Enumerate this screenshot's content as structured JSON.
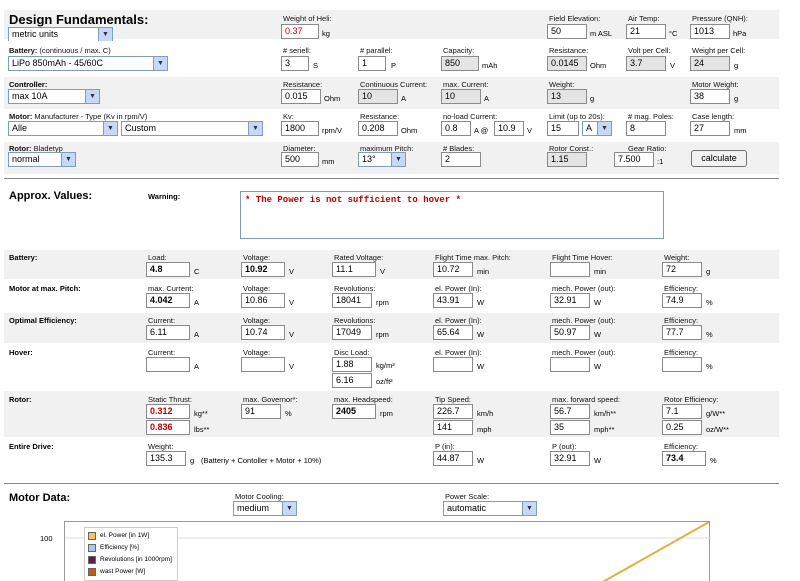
{
  "design": {
    "title": "Design Fundamentals:",
    "units": "metric units"
  },
  "heli_weight": {
    "label": "Weight of Heli:",
    "value": "0.37",
    "unit": "kg"
  },
  "field": {
    "label": "Field Elevation:",
    "value": "50",
    "unit": "m ASL"
  },
  "air": {
    "label": "Air Temp:",
    "value": "21",
    "unit": "°C"
  },
  "pressure": {
    "label": "Pressure (QNH):",
    "value": "1013",
    "unit": "hPa"
  },
  "battery": {
    "label_bold": "Battery:",
    "label_rest": " (continuous / max. C)",
    "type": "LiPo 850mAh - 45/60C",
    "seriell_label": "# seriell:",
    "seriell": "3",
    "seriell_unit": "S",
    "parallel_label": "# parallel:",
    "parallel": "1",
    "parallel_unit": "P",
    "capacity_label": "Capacity:",
    "capacity": "850",
    "capacity_unit": "mAh",
    "resistance_label": "Resistance:",
    "resistance": "0.0145",
    "resistance_unit": "Ohm",
    "volt_label": "Volt per Cell:",
    "volt": "3.7",
    "volt_unit": "V",
    "weight_label": "Weight per Cell:",
    "weight": "24",
    "weight_unit": "g"
  },
  "controller": {
    "label": "Controller:",
    "type": "max 10A",
    "resistance_label": "Resistance:",
    "resistance": "0.015",
    "resistance_unit": "Ohm",
    "cont_label": "Continuous Current:",
    "cont": "10",
    "cont_unit": "A",
    "max_label": "max. Current:",
    "max": "10",
    "max_unit": "A",
    "weight_label": "Weight:",
    "weight": "13",
    "weight_unit": "g",
    "motor_weight_label": "Motor Weight:",
    "motor_weight": "38",
    "motor_weight_unit": "g"
  },
  "motor": {
    "label_bold": "Motor:",
    "label_rest": " Manufacturer - Type (Kv in rpm/V)",
    "manufacturer": "Alle",
    "type": "Custom",
    "kv_label": "Kv:",
    "kv": "1800",
    "kv_unit": "rpm/V",
    "resistance_label": "Resistance:",
    "resistance": "0.208",
    "resistance_unit": "Ohm",
    "noload_label": "no-load Current:",
    "noload": "0.8",
    "noload_mid": "A @",
    "noload_v": "10.9",
    "noload_unit": "V",
    "limit_label": "Limit (up to 20s):",
    "limit": "15",
    "limit_unit": "A",
    "poles_label": "# mag. Poles:",
    "poles": "8",
    "case_label": "Case length:",
    "case": "27",
    "case_unit": "mm"
  },
  "rotor": {
    "label_bold": "Rotor:",
    "label_rest": " Bladetyp",
    "type": "normal",
    "diameter_label": "Diameter:",
    "diameter": "500",
    "diameter_unit": "mm",
    "pitch_label": "maximum Pitch:",
    "pitch": "13°",
    "blades_label": "# Blades:",
    "blades": "2",
    "const_label": "Rotor Const.:",
    "const": "1.15",
    "gear_label": "Gear Ratio:",
    "gear": "7.500",
    "gear_unit": ":1",
    "calculate": "calculate"
  },
  "approx": {
    "title": "Approx. Values:",
    "warning_label": "Warning:",
    "warning_text": "* The Power is not sufficient to hover *"
  },
  "bat_row": {
    "label": "Battery:",
    "load_label": "Load:",
    "load": "4.8",
    "load_unit": "C",
    "voltage_label": "Voltage:",
    "voltage": "10.92",
    "voltage_unit": "V",
    "rated_label": "Rated Voltage:",
    "rated": "11.1",
    "rated_unit": "V",
    "ftmax_label": "Flight Time max. Pitch:",
    "ftmax": "10.72",
    "ftmax_unit": "min",
    "fthover_label": "Flight Time Hover:",
    "fthover": "",
    "fthover_unit": "min",
    "weight_label": "Weight:",
    "weight": "72",
    "weight_unit": "g"
  },
  "motor_row": {
    "label": "Motor at max. Pitch:",
    "current_label": "max. Current:",
    "current": "4.042",
    "current_unit": "A",
    "voltage_label": "Voltage:",
    "voltage": "10.86",
    "voltage_unit": "V",
    "rev_label": "Revolutions:",
    "rev": "18041",
    "rev_unit": "rpm",
    "pin_label": "el. Power (In):",
    "pin": "43.91",
    "pin_unit": "W",
    "pout_label": "mech. Power (out):",
    "pout": "32.91",
    "pout_unit": "W",
    "eff_label": "Efficiency:",
    "eff": "74.9",
    "eff_unit": "%"
  },
  "opt_row": {
    "label": "Optimal Efficiency:",
    "current_label": "Current:",
    "current": "6.11",
    "current_unit": "A",
    "voltage_label": "Voltage:",
    "voltage": "10.74",
    "voltage_unit": "V",
    "rev_label": "Revolutions:",
    "rev": "17049",
    "rev_unit": "rpm",
    "pin_label": "el. Power (In):",
    "pin": "65.64",
    "pin_unit": "W",
    "pout_label": "mech. Power (out):",
    "pout": "50.97",
    "pout_unit": "W",
    "eff_label": "Efficiency:",
    "eff": "77.7",
    "eff_unit": "%"
  },
  "hover_row": {
    "label": "Hover:",
    "current_label": "Current:",
    "current": "",
    "current_unit": "A",
    "voltage_label": "Voltage:",
    "voltage": "",
    "voltage_unit": "V",
    "disc_label": "Disc Load:",
    "disc1": "1.88",
    "disc1_unit": "kg/m²",
    "disc2": "6.16",
    "disc2_unit": "oz/ft²",
    "pin_label": "el. Power (In):",
    "pin": "",
    "pin_unit": "W",
    "pout_label": "mech. Power (out):",
    "pout": "",
    "pout_unit": "W",
    "eff_label": "Efficiency:",
    "eff": "",
    "eff_unit": "%"
  },
  "rotor_row": {
    "label": "Rotor:",
    "thrust_label": "Static Thrust:",
    "thrust1": "0.312",
    "thrust1_unit": "kg**",
    "thrust2": "0.836",
    "thrust2_unit": "lbs**",
    "gov_label": "max. Governor*:",
    "gov": "91",
    "gov_unit": "%",
    "head_label": "max. Headspeed:",
    "head": "2405",
    "head_unit": "rpm",
    "tip_label": "Tip Speed:",
    "tip1": "226.7",
    "tip1_unit": "km/h",
    "tip2": "141",
    "tip2_unit": "mph",
    "fwd_label": "max. forward speed:",
    "fwd1": "56.7",
    "fwd1_unit": "km/h**",
    "fwd2": "35",
    "fwd2_unit": "mph**",
    "reff_label": "Rotor Efficiency:",
    "reff1": "7.1",
    "reff1_unit": "g/W**",
    "reff2": "0.25",
    "reff2_unit": "oz/W**"
  },
  "drive_row": {
    "label": "Entire Drive:",
    "weight_label": "Weight:",
    "weight": "135.3",
    "weight_unit": "g",
    "weight_note": "(Batteriy + Contoller + Motor + 10%)",
    "pin_label": "P (in):",
    "pin": "44.87",
    "pin_unit": "W",
    "pout_label": "P (out):",
    "pout": "32.91",
    "pout_unit": "W",
    "eff_label": "Efficiency:",
    "eff": "73.4",
    "eff_unit": "%"
  },
  "motor_data": {
    "title": "Motor Data:",
    "cooling_label": "Motor Cooling:",
    "cooling": "medium",
    "scale_label": "Power Scale:",
    "scale": "automatic"
  },
  "chart_data": {
    "type": "line",
    "ylim": [
      0,
      100
    ],
    "ytick": "100",
    "legend_placement": "top-left",
    "series": [
      {
        "name": "el. Power [in 1W]",
        "color": "#f5c265"
      },
      {
        "name": "Efficiency [%]",
        "color": "#a9c8ee"
      },
      {
        "name": "Revolutions [in 1000rpm]",
        "color": "#6a1a4a"
      },
      {
        "name": "wast Power [W]",
        "color": "#c25a10"
      }
    ]
  }
}
